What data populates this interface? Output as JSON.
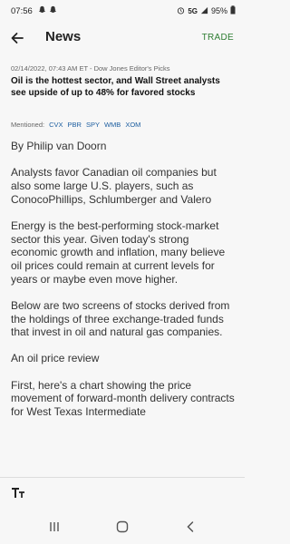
{
  "status_bar": {
    "time": "07:56",
    "network": "5G",
    "battery": "95%"
  },
  "app_bar": {
    "title": "News",
    "trade_label": "TRADE"
  },
  "article": {
    "meta": "02/14/2022, 07:43 AM ET - Dow Jones Editor's Picks",
    "headline": "Oil is the hottest sector, and Wall Street analysts see upside of up to 48% for favored stocks",
    "mentioned_label": "Mentioned:",
    "tickers": [
      "CVX",
      "PBR",
      "SPY",
      "WMB",
      "XOM"
    ],
    "paragraphs": [
      "By Philip van Doorn",
      "Analysts favor Canadian oil companies but also some large U.S. players, such as ConocoPhillips, Schlumberger and Valero",
      "Energy is the best-performing stock-market sector this year. Given today's strong economic growth and inflation, many believe oil prices could remain at current levels for years or maybe even move higher.",
      "Below are two screens of stocks derived from the holdings of three exchange-traded funds that invest in oil and natural gas companies.",
      "An oil price review",
      "First, here's a chart showing the price movement of forward-month delivery contracts for West Texas Intermediate"
    ]
  },
  "colors": {
    "accent": "#2e7d32",
    "ticker": "#1e5fa0"
  }
}
